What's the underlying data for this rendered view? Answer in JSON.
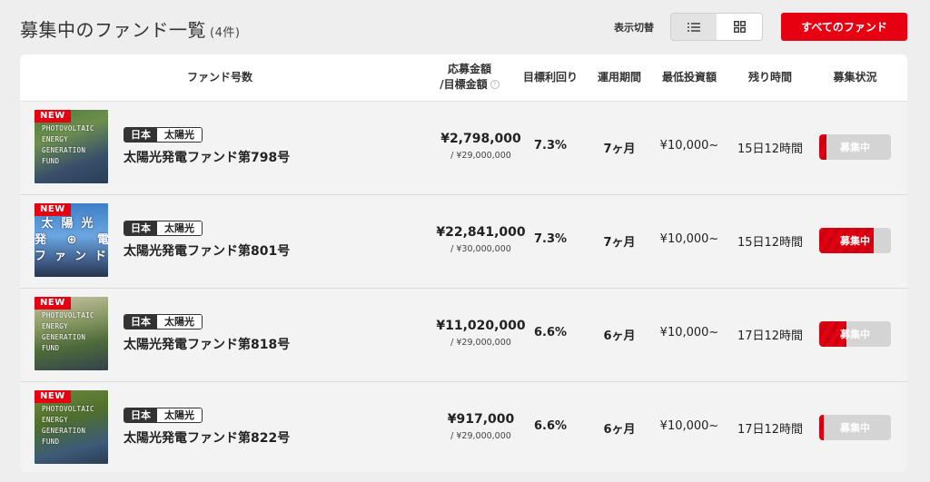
{
  "header": {
    "title": "募集中のファンド一覧",
    "count": "(4件)",
    "toggle_label": "表示切替",
    "all_funds_label": "すべてのファンド"
  },
  "table": {
    "columns": {
      "name": "ファンド号数",
      "amount_line1": "応募金額",
      "amount_line2": "/目標金額",
      "yield": "目標利回り",
      "period": "運用期間",
      "min_invest": "最低投資額",
      "remaining": "残り時間",
      "status": "募集状況"
    },
    "help_icon": "?",
    "rows": [
      {
        "badge": "NEW",
        "thumb_text": "PHOTOVOLTAIC\nENERGY\nGENERATION\nFUND",
        "country": "日本",
        "type": "太陽光",
        "name": "太陽光発電ファンド第798号",
        "amount": "¥2,798,000",
        "target": "/ ¥29,000,000",
        "yield": "7.3%",
        "period": "7ヶ月",
        "min_invest": "¥10,000~",
        "remaining": "15日12時間",
        "status": "募集中",
        "progress": 0.096
      },
      {
        "badge": "NEW",
        "thumb_text": "太陽光\n発 ⊕ 電\nファンド",
        "country": "日本",
        "type": "太陽光",
        "name": "太陽光発電ファンド第801号",
        "amount": "¥22,841,000",
        "target": "/ ¥30,000,000",
        "yield": "7.3%",
        "period": "7ヶ月",
        "min_invest": "¥10,000~",
        "remaining": "15日12時間",
        "status": "募集中",
        "progress": 0.761
      },
      {
        "badge": "NEW",
        "thumb_text": "PHOTOVOLTAIC\nENERGY\nGENERATION\nFUND",
        "country": "日本",
        "type": "太陽光",
        "name": "太陽光発電ファンド第818号",
        "amount": "¥11,020,000",
        "target": "/ ¥29,000,000",
        "yield": "6.6%",
        "period": "6ヶ月",
        "min_invest": "¥10,000~",
        "remaining": "17日12時間",
        "status": "募集中",
        "progress": 0.38
      },
      {
        "badge": "NEW",
        "thumb_text": "PHOTOVOLTAIC\nENERGY\nGENERATION\nFUND",
        "country": "日本",
        "type": "太陽光",
        "name": "太陽光発電ファンド第822号",
        "amount": "¥917,000",
        "target": "/ ¥29,000,000",
        "yield": "6.6%",
        "period": "6ヶ月",
        "min_invest": "¥10,000~",
        "remaining": "17日12時間",
        "status": "募集中",
        "progress": 0.032
      }
    ]
  },
  "colors": {
    "accent": "#e60012",
    "page_bg": "#eeeeee"
  },
  "icons": {
    "list_view": "list-view-icon",
    "grid_view": "grid-view-icon"
  }
}
